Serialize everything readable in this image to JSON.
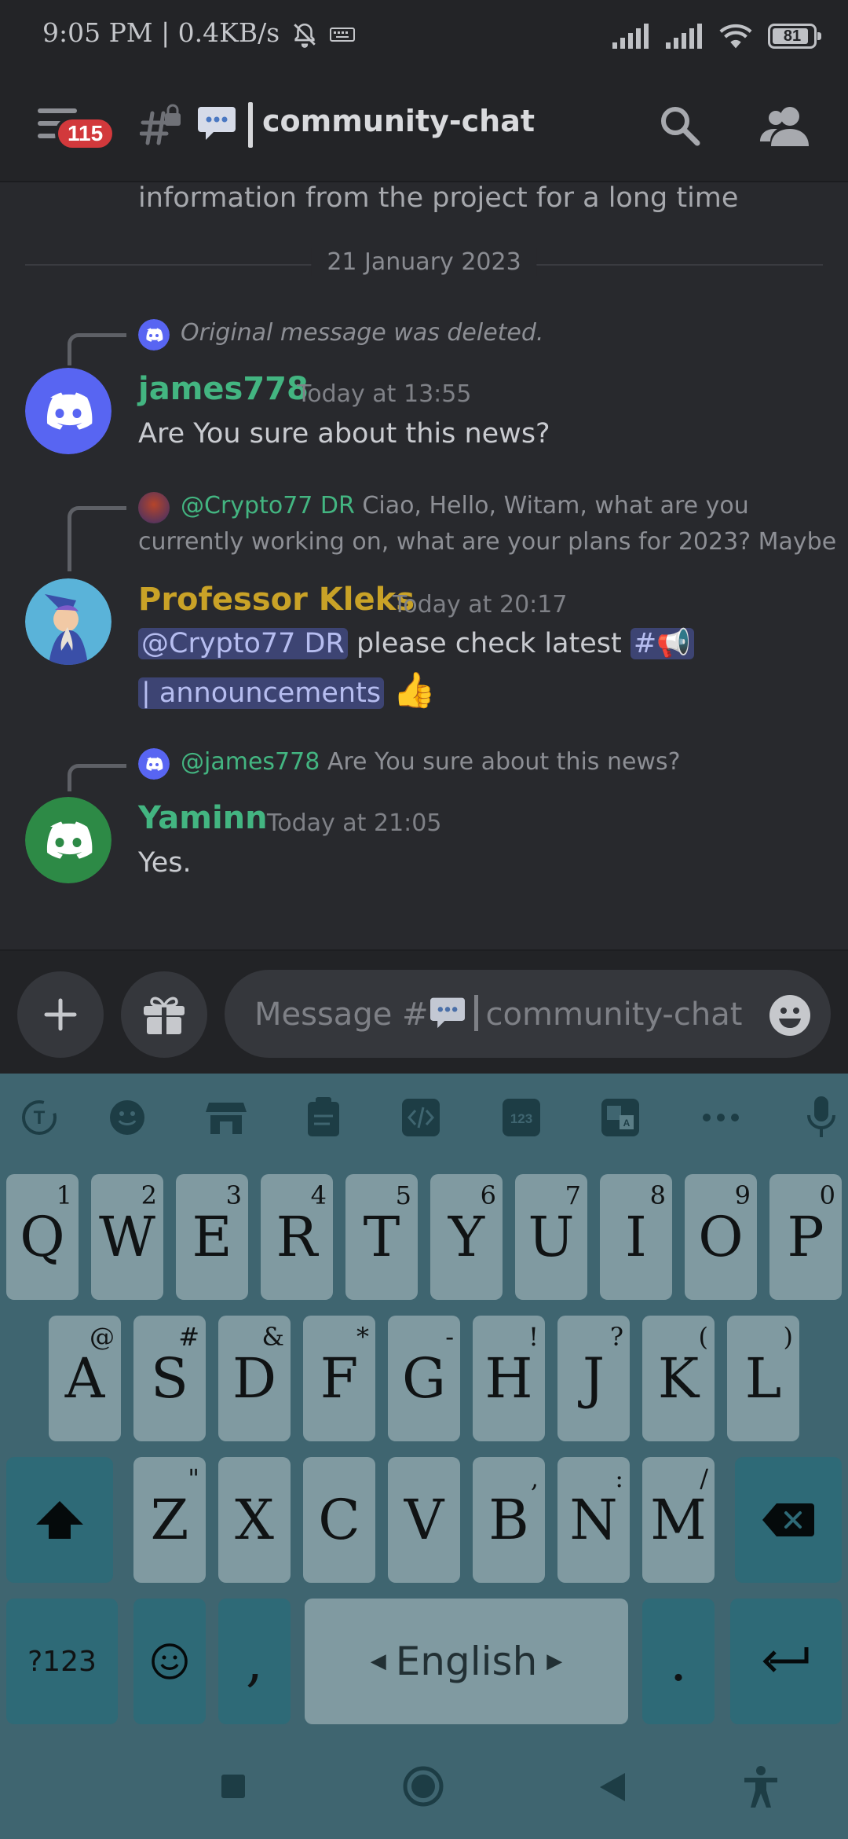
{
  "status_bar": {
    "left_text": "9:05 PM | 0.4KB/s",
    "battery": "81",
    "battery_level": 0.81
  },
  "header": {
    "unread_badge": "115",
    "channel_name": "community-chat",
    "icons": [
      "menu-icon",
      "locked-hash-icon",
      "speech-balloon-icon",
      "search-icon",
      "members-icon"
    ]
  },
  "chat": {
    "previous_text": "information from the project for a long time",
    "date_divider": "21 January 2023",
    "messages": [
      {
        "reply_text": "Original message was deleted.",
        "author": "james778",
        "author_color": "#43b581",
        "timestamp": "Today at 13:55",
        "lines": [
          "Are You sure about this news?"
        ]
      },
      {
        "reply_mention": "@Crypto77 DR",
        "reply_text_1": "Ciao, Hello, Witam, what are you",
        "reply_text_2": "currently working on, what are your plans for 2023? Maybe",
        "author": "Professor Kleks",
        "author_color": "#c9a227",
        "timestamp": "Today at 20:17",
        "mention": "@Crypto77 DR",
        "text": "please check latest",
        "channel_link_prefix": "#",
        "channel_link_name": "announcements",
        "emoji": "👍"
      },
      {
        "reply_mention": "@james778",
        "reply_text": "Are You sure about this news?",
        "author": "Yaminn",
        "author_color": "#43b581",
        "timestamp": "Today at 21:05",
        "lines": [
          "Yes."
        ]
      }
    ]
  },
  "composer": {
    "placeholder_prefix": "Message #",
    "placeholder_channel": "community-chat"
  },
  "keyboard": {
    "row1": [
      {
        "key": "Q",
        "sub": "1"
      },
      {
        "key": "W",
        "sub": "2"
      },
      {
        "key": "E",
        "sub": "3"
      },
      {
        "key": "R",
        "sub": "4"
      },
      {
        "key": "T",
        "sub": "5"
      },
      {
        "key": "Y",
        "sub": "6"
      },
      {
        "key": "U",
        "sub": "7"
      },
      {
        "key": "I",
        "sub": "8"
      },
      {
        "key": "O",
        "sub": "9"
      },
      {
        "key": "P",
        "sub": "0"
      }
    ],
    "row2": [
      {
        "key": "A",
        "sub": "@"
      },
      {
        "key": "S",
        "sub": "#"
      },
      {
        "key": "D",
        "sub": "&"
      },
      {
        "key": "F",
        "sub": "*"
      },
      {
        "key": "G",
        "sub": "-"
      },
      {
        "key": "H",
        "sub": "!"
      },
      {
        "key": "J",
        "sub": "?"
      },
      {
        "key": "K",
        "sub": "("
      },
      {
        "key": "L",
        "sub": ")"
      }
    ],
    "row3": [
      {
        "key": "Z",
        "sub": "\""
      },
      {
        "key": "X",
        "sub": ""
      },
      {
        "key": "C",
        "sub": ""
      },
      {
        "key": "V",
        "sub": ""
      },
      {
        "key": "B",
        "sub": ""
      },
      {
        "key": "N",
        "sub": ":"
      },
      {
        "key": "M",
        "sub": "/"
      }
    ],
    "symbols_label": "?123",
    "comma": ",",
    "space_label": "English",
    "period": "."
  }
}
